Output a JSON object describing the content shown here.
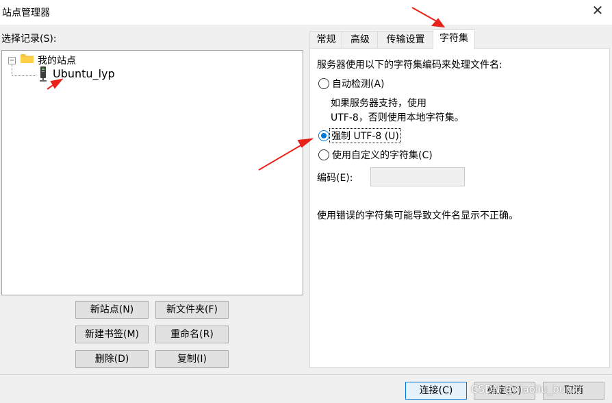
{
  "window": {
    "title": "站点管理器",
    "close_glyph": "✕"
  },
  "tree": {
    "section_label": "选择记录(S):",
    "root": {
      "label": "我的站点",
      "expander": "−",
      "icon": "folder-icon"
    },
    "items": [
      {
        "label": "Ubuntu_lyp",
        "icon": "server-icon"
      }
    ]
  },
  "left_buttons": [
    {
      "label": "新站点(N)"
    },
    {
      "label": "新文件夹(F)"
    },
    {
      "label": "新建书签(M)"
    },
    {
      "label": "重命名(R)"
    },
    {
      "label": "删除(D)"
    },
    {
      "label": "复制(I)"
    }
  ],
  "tabs": [
    {
      "label": "常规",
      "active": false
    },
    {
      "label": "高级",
      "active": false
    },
    {
      "label": "传输设置",
      "active": false
    },
    {
      "label": "字符集",
      "active": true
    }
  ],
  "charset": {
    "intro": "服务器使用以下的字符集编码来处理文件名:",
    "options": [
      {
        "label": "自动检测(A)",
        "checked": false
      },
      {
        "label": "强制 UTF-8 (U)",
        "checked": true
      },
      {
        "label": "使用自定义的字符集(C)",
        "checked": false
      }
    ],
    "auto_desc_line1": "如果服务器支持，使用",
    "auto_desc_line2": "UTF-8，否则使用本地字符集。",
    "encoding_label": "编码(E):",
    "encoding_value": "",
    "warning": "使用错误的字符集可能导致文件名显示不正确。"
  },
  "footer_buttons": [
    {
      "label": "连接(C)"
    },
    {
      "label": "确定(O)"
    },
    {
      "label": "取消"
    }
  ],
  "watermark": "CSDN @xiaoliu_buniu",
  "colors": {
    "accent": "#0078d7",
    "annotation_arrow": "#e8221b"
  }
}
